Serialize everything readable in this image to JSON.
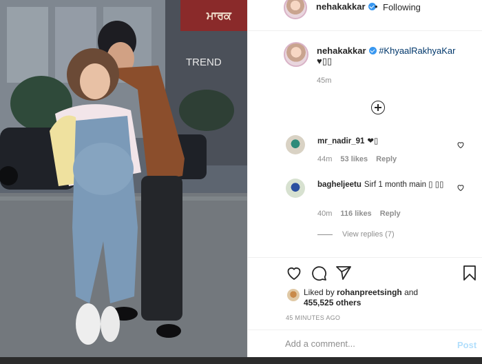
{
  "header": {
    "username": "nehakakkar",
    "separator": "•",
    "follow_status": "Following"
  },
  "caption": {
    "username": "nehakakkar",
    "hashtag": "#KhyaalRakhyaKar",
    "text": "♥▯▯",
    "time": "45m"
  },
  "comments": [
    {
      "username": "mr_nadir_91",
      "text": "❤▯",
      "time": "44m",
      "likes": "53 likes",
      "reply_label": "Reply"
    },
    {
      "username": "bagheljeetu",
      "text": "Sirf 1 month main ▯ ▯▯",
      "time": "40m",
      "likes": "116 likes",
      "reply_label": "Reply",
      "view_replies": "View replies (7)"
    }
  ],
  "actions": {
    "icons": [
      "heart-icon",
      "comment-icon",
      "share-icon",
      "bookmark-icon"
    ],
    "liked_by_prefix": "Liked by",
    "liked_by_user": "rohanpreetsingh",
    "liked_by_and": "and",
    "others_count": "455,525 others",
    "time_ago": "45 MINUTES AGO"
  },
  "add_comment": {
    "placeholder": "Add a comment...",
    "post_label": "Post"
  },
  "photo": {
    "sign_text": "ਮਾਰਕ",
    "store_text": "TREND"
  },
  "colors": {
    "link": "#00376b",
    "verified": "#3897f0",
    "muted": "#8e8e8e",
    "post_disabled": "#b2dffc"
  }
}
